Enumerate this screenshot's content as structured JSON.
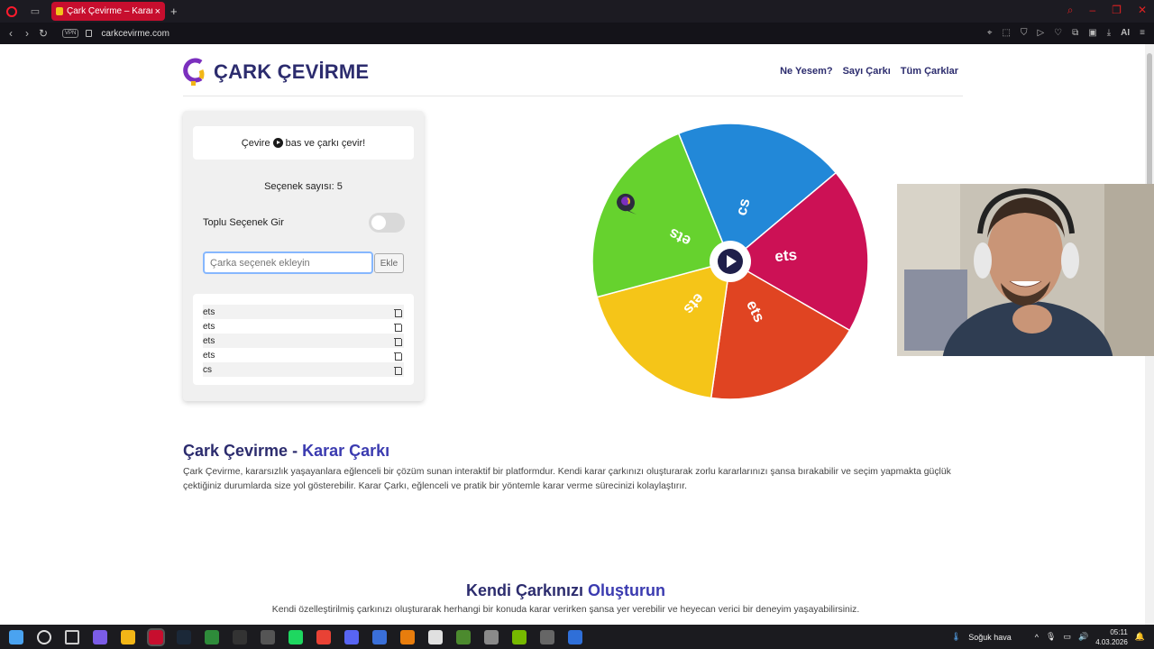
{
  "browser": {
    "tab_title": "Çark Çevirme – Karar Çarkı",
    "tab_close": "×",
    "new_tab": "+",
    "url": "carkcevirme.com",
    "vpn_label": "VPN",
    "ai_label": "AI"
  },
  "site": {
    "brand": "ÇARK ÇEVİRME",
    "nav": [
      "Ne Yesem?",
      "Sayı Çarkı",
      "Tüm Çarklar"
    ]
  },
  "panel": {
    "hint_prefix": "Çevire",
    "hint_suffix": "bas ve çarkı çevir!",
    "count_label": "Seçenek sayısı: 5",
    "bulk_label": "Toplu Seçenek Gir",
    "bulk_enabled": false,
    "input_placeholder": "Çarka seçenek ekleyin",
    "input_value": "",
    "add_label": "Ekle",
    "options": [
      "ets",
      "ets",
      "ets",
      "ets",
      "cs"
    ]
  },
  "wheel": {
    "segments": [
      {
        "label": "cs",
        "color": "#2288d8"
      },
      {
        "label": "ets",
        "color": "#cc1155"
      },
      {
        "label": "ets",
        "color": "#e04422"
      },
      {
        "label": "ets",
        "color": "#f5c518"
      },
      {
        "label": "ets",
        "color": "#66d22e"
      }
    ]
  },
  "content": {
    "h1_main": "Çark Çevirme - ",
    "h1_accent": "Karar Çarkı",
    "paragraph": "Çark Çevirme, kararsızlık yaşayanlara eğlenceli bir çözüm sunan interaktif bir platformdur. Kendi karar çarkınızı oluşturarak zorlu kararlarınızı şansa bırakabilir ve seçim yapmakta güçlük çektiğiniz durumlarda size yol gösterebilir. Karar Çarkı, eğlenceli ve pratik bir yöntemle karar verme sürecinizi kolaylaştırır.",
    "h2_main": "Kendi Çarkınızı ",
    "h2_accent": "Oluşturun",
    "paragraph2": "Kendi özelleştirilmiş çarkınızı oluşturarak herhangi bir konuda karar verirken şansa yer verebilir ve heyecan verici bir deneyim yaşayabilirsiniz."
  },
  "taskbar": {
    "weather": "Soğuk hava",
    "time": "05:11",
    "date": "4.03.2026",
    "apps": [
      "windows",
      "search",
      "task-view",
      "copilot",
      "file-explorer",
      "opera",
      "steam",
      "xbox",
      "epic-games",
      "obs",
      "spotify",
      "chrome",
      "discord",
      "app",
      "blender",
      "cs",
      "minecraft",
      "app2",
      "nvidia",
      "app3",
      "tb"
    ],
    "app_colors": [
      "#4aa3f0",
      "#ddd",
      "#ccc",
      "#7b5ce6",
      "#f2b617",
      "#c70e2e",
      "#1b2838",
      "#2e8b3a",
      "#333",
      "#555",
      "#1ed760",
      "#e94235",
      "#5865f2",
      "#3a6fd8",
      "#e87d0d",
      "#e0e0e0",
      "#4c8a2e",
      "#8a8a8a",
      "#76b900",
      "#666",
      "#2f6fd8"
    ]
  }
}
